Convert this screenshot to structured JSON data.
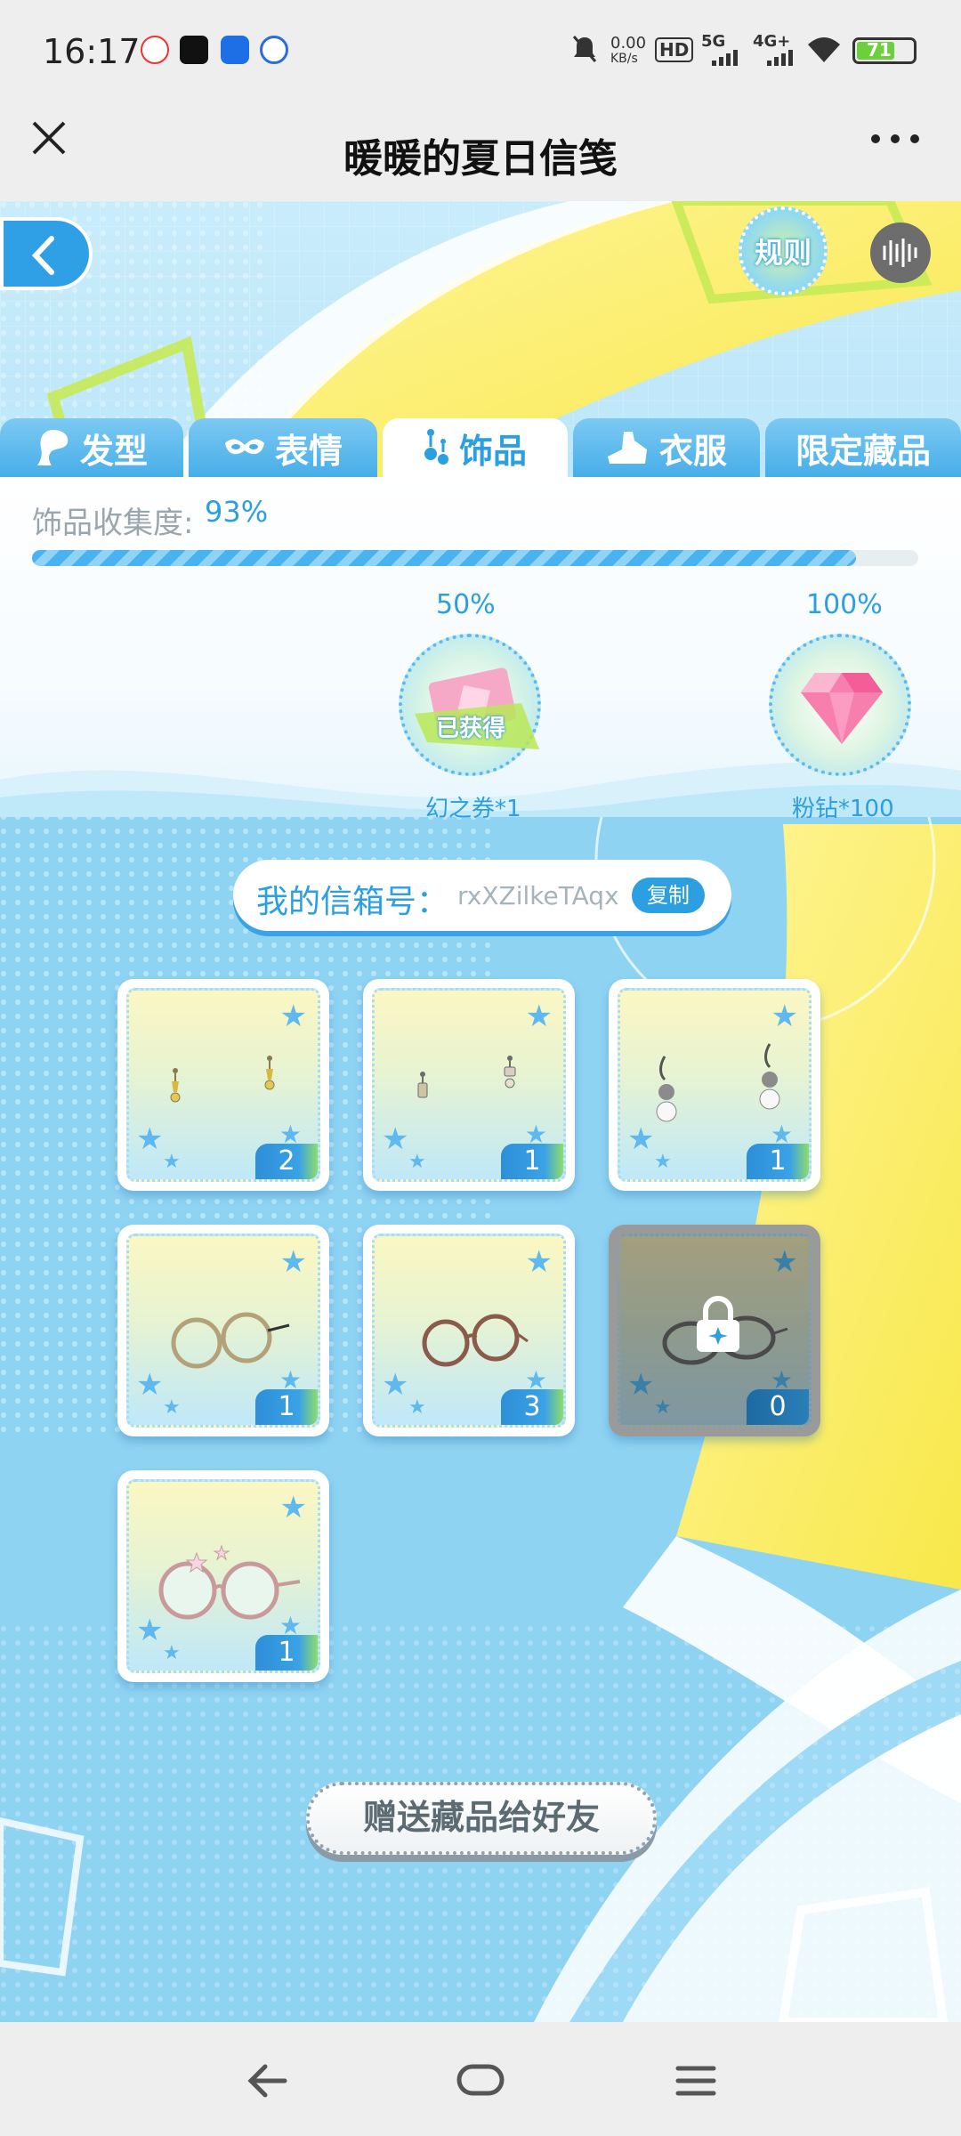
{
  "status_bar": {
    "time": "16:17",
    "net_speed": "0.00",
    "net_unit": "KB/s",
    "hd": "HD",
    "net1": "5G",
    "net2": "4G+",
    "battery": "71"
  },
  "title_bar": {
    "title": "暖暖的夏日信笺",
    "close_icon": "close-icon",
    "more_icon": "more-icon"
  },
  "header": {
    "rules_label": "规则"
  },
  "tabs": [
    {
      "label": "发型",
      "icon": "hair-icon",
      "active": false
    },
    {
      "label": "表情",
      "icon": "mask-icon",
      "active": false
    },
    {
      "label": "饰品",
      "icon": "earring-icon",
      "active": true
    },
    {
      "label": "衣服",
      "icon": "clothes-icon",
      "active": false
    },
    {
      "label": "限定藏品",
      "icon": "",
      "active": false
    }
  ],
  "collection": {
    "label": "饰品收集度:",
    "percent_text": "93%",
    "progress": 0.93,
    "milestones": [
      {
        "threshold": "50%",
        "reward": "幻之券*1",
        "status": "已获得"
      },
      {
        "threshold": "100%",
        "reward": "粉钻*100",
        "status": ""
      }
    ]
  },
  "mailbox": {
    "label": "我的信箱号：",
    "code": "rxXZilkeTAqx",
    "copy_label": "复制"
  },
  "items": [
    {
      "name": "gold-earrings",
      "count": "2",
      "locked": false
    },
    {
      "name": "charm-earrings",
      "count": "1",
      "locked": false
    },
    {
      "name": "pearl-earrings",
      "count": "1",
      "locked": false
    },
    {
      "name": "gold-round-glasses",
      "count": "1",
      "locked": false
    },
    {
      "name": "brown-round-glasses",
      "count": "3",
      "locked": false
    },
    {
      "name": "chain-glasses",
      "count": "0",
      "locked": true
    },
    {
      "name": "star-glasses",
      "count": "1",
      "locked": false
    }
  ],
  "gift_button": "赠送藏品给好友",
  "colors": {
    "accent": "#2b9fe0",
    "progress": "#48b3ee",
    "badge": "#2d8fd8"
  }
}
